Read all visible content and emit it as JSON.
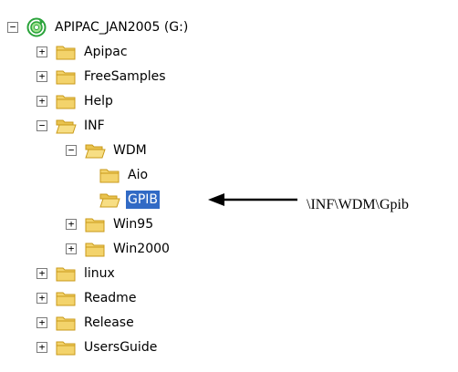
{
  "tree": {
    "root": {
      "label": "APIPAC_JAN2005 (G:)",
      "icon": "cd-drive-icon",
      "expanded": true
    },
    "items": [
      {
        "label": "Apipac",
        "expander": "+"
      },
      {
        "label": "FreeSamples",
        "expander": "+"
      },
      {
        "label": "Help",
        "expander": "+"
      },
      {
        "label": "INF",
        "expander": "−"
      },
      {
        "label": "WDM",
        "expander": "−"
      },
      {
        "label": "Aio",
        "expander": ""
      },
      {
        "label": "GPIB",
        "expander": "",
        "selected": true
      },
      {
        "label": "Win95",
        "expander": "+"
      },
      {
        "label": "Win2000",
        "expander": "+"
      },
      {
        "label": "linux",
        "expander": "+"
      },
      {
        "label": "Readme",
        "expander": "+"
      },
      {
        "label": "Release",
        "expander": "+"
      },
      {
        "label": "UsersGuide",
        "expander": "+"
      }
    ],
    "root_expander": "−"
  },
  "annotation": {
    "path_text": "\\INF\\WDM\\Gpib"
  },
  "colors": {
    "selection": "#316ac5",
    "folder_body": "#f3d36b",
    "folder_dark": "#c99a18",
    "drive_green": "#2aa33a"
  }
}
